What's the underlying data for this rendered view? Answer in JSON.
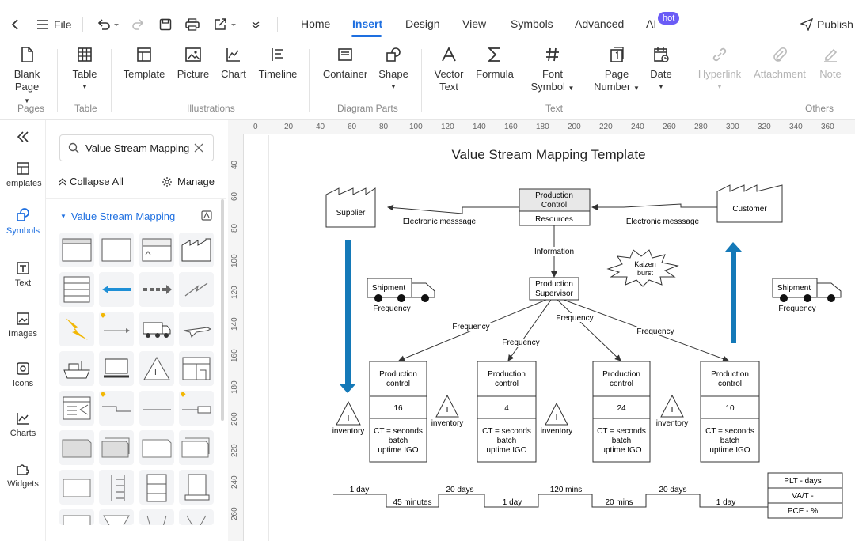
{
  "topbar": {
    "file_label": "File",
    "tabs": [
      "Home",
      "Insert",
      "Design",
      "View",
      "Symbols",
      "Advanced",
      "AI"
    ],
    "active_tab": "Insert",
    "hot_badge": "hot",
    "publish_label": "Publish"
  },
  "ribbon": {
    "blank_page": [
      "Blank",
      "Page"
    ],
    "table": "Table",
    "template": "Template",
    "picture": "Picture",
    "chart": "Chart",
    "timeline": "Timeline",
    "container": "Container",
    "shape": "Shape",
    "vector_text": [
      "Vector",
      "Text"
    ],
    "formula": "Formula",
    "font_symbol": [
      "Font",
      "Symbol"
    ],
    "page_number": [
      "Page",
      "Number"
    ],
    "date": "Date",
    "hyperlink": "Hyperlink",
    "attachment": "Attachment",
    "note": "Note",
    "groups": {
      "pages": "Pages",
      "table": "Table",
      "illustrations": "Illustrations",
      "diagram_parts": "Diagram Parts",
      "text": "Text",
      "others": "Others"
    }
  },
  "rail": {
    "items": [
      "emplates",
      "Symbols",
      "Text",
      "Images",
      "Icons",
      "Charts",
      "Widgets"
    ]
  },
  "library": {
    "search_value": "Value Stream Mapping",
    "collapse_all": "Collapse All",
    "manage": "Manage",
    "section_title": "Value Stream Mapping"
  },
  "ruler": {
    "top": [
      "0",
      "20",
      "40",
      "60",
      "80",
      "100",
      "120",
      "140",
      "160",
      "180",
      "200",
      "220",
      "240",
      "260",
      "280",
      "300",
      "320",
      "340",
      "360"
    ],
    "left": [
      "40",
      "60",
      "80",
      "100",
      "120",
      "140",
      "160",
      "180",
      "200",
      "220",
      "240",
      "260"
    ]
  },
  "diagram": {
    "title": "Value Stream Mapping Template",
    "supplier": "Supplier",
    "customer": "Customer",
    "production_control": [
      "Production",
      "Control"
    ],
    "resources": "Resources",
    "electronic_message": "Electronic messsage",
    "information": "Information",
    "kaizen": [
      "Kaizen",
      "burst"
    ],
    "production_supervisor": [
      "Production",
      "Supervisor"
    ],
    "shipment": "Shipment",
    "frequency": "Frequency",
    "inventory": "inventory",
    "inventory_symbol": "I",
    "processes": [
      {
        "title": [
          "Production",
          "control"
        ],
        "value": "16",
        "info": [
          "CT = seconds",
          "batch",
          "uptime IGO"
        ]
      },
      {
        "title": [
          "Production",
          "control"
        ],
        "value": "4",
        "info": [
          "CT = seconds",
          "batch",
          "uptime IGO"
        ]
      },
      {
        "title": [
          "Production",
          "control"
        ],
        "value": "24",
        "info": [
          "CT = seconds",
          "batch",
          "uptime IGO"
        ]
      },
      {
        "title": [
          "Production",
          "control"
        ],
        "value": "10",
        "info": [
          "CT = seconds",
          "batch",
          "uptime IGO"
        ]
      }
    ],
    "timeline_top": [
      "1 day",
      "20 days",
      "120 mins",
      "20 days"
    ],
    "timeline_bottom": [
      "45 minutes",
      "1 day",
      "20 mins",
      "1 day"
    ],
    "summary": [
      "PLT - days",
      "VA/T -",
      "PCE - %"
    ],
    "colors": {
      "arrow": "#1479b8",
      "accent": "#1e6fe0",
      "lightning": "#f2b705"
    }
  }
}
